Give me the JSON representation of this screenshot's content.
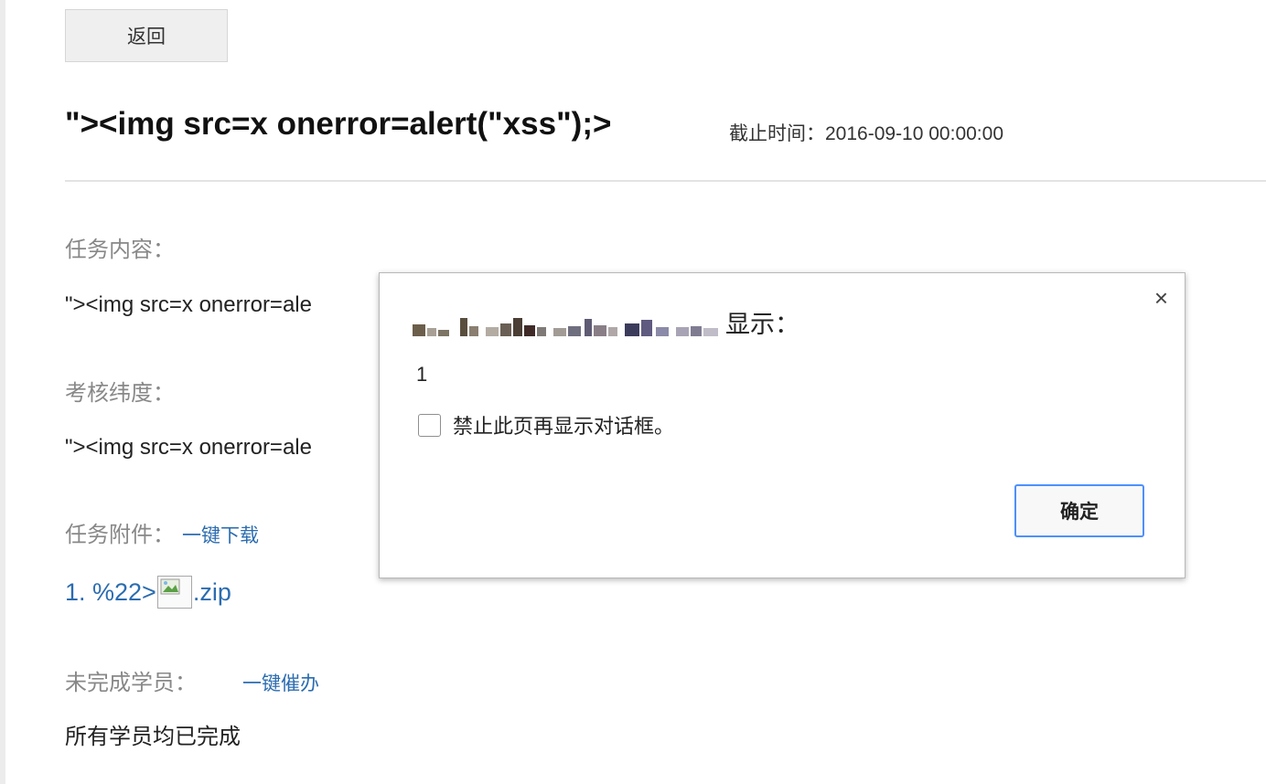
{
  "page": {
    "back_label": "返回",
    "title": "\"><img src=x onerror=alert(\"xss\");>",
    "deadline": "截止时间：2016-09-10 00:00:00"
  },
  "sections": {
    "task_content_label": "任务内容：",
    "task_content_value": "\"><img src=x onerror=ale",
    "assessment_label": "考核纬度：",
    "assessment_value": "\"><img src=x onerror=ale",
    "attachments_label": "任务附件：",
    "download_all": "一键下载",
    "attachment_prefix": "1. %22>",
    "attachment_suffix": ".zip",
    "unfinished_label": "未完成学员：",
    "remind_all": "一键催办",
    "all_done": "所有学员均已完成"
  },
  "dialog": {
    "header_suffix": "显示：",
    "message": "1",
    "suppress_label": "禁止此页再显示对话框。",
    "ok_label": "确定",
    "close_glyph": "×"
  },
  "colors": {
    "link": "#2b6cb0",
    "ok_border": "#4d90fe"
  }
}
